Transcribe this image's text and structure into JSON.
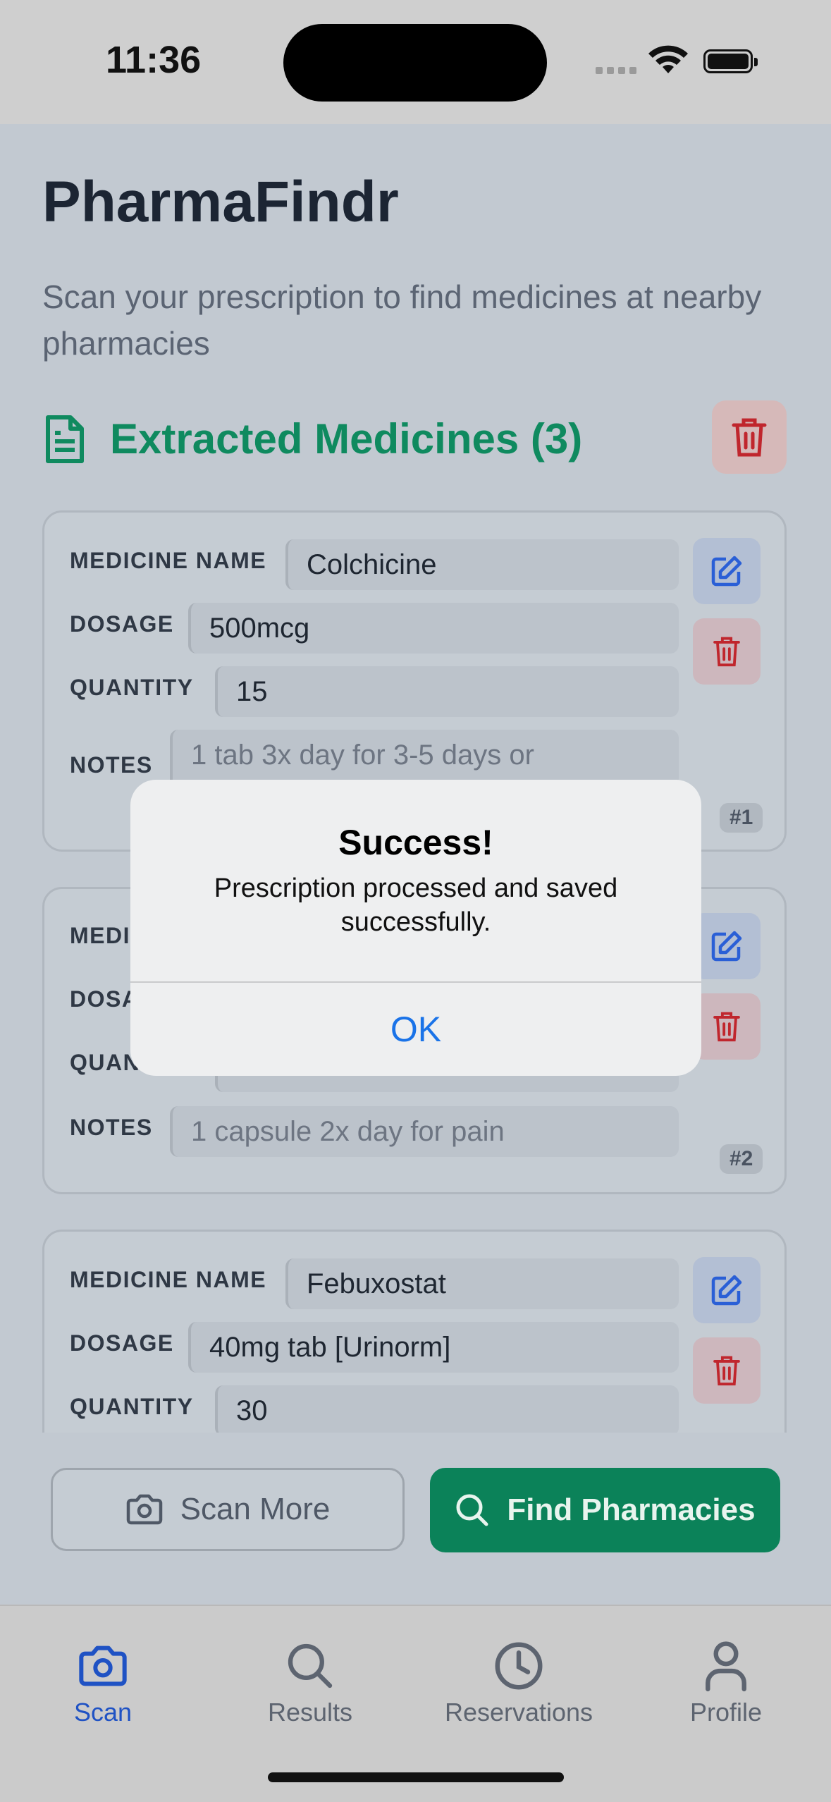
{
  "status_bar": {
    "time": "11:36"
  },
  "header": {
    "title": "PharmaFindr",
    "subtitle": "Scan your prescription to find medicines at nearby pharmacies"
  },
  "section": {
    "title": "Extracted Medicines (3)"
  },
  "labels": {
    "medicine_name": "MEDICINE NAME",
    "dosage": "DOSAGE",
    "quantity": "QUANTITY",
    "notes": "NOTES"
  },
  "medicines": [
    {
      "name": "Colchicine",
      "dosage": "500mcg",
      "quantity": "15",
      "notes": "1 tab 3x day for 3-5 days or",
      "badge": "#1"
    },
    {
      "name": "",
      "dosage": "",
      "quantity": "",
      "notes": "1 capsule 2x day for pain",
      "badge": "#2"
    },
    {
      "name": "Febuxostat",
      "dosage": "40mg tab [Urinorm]",
      "quantity": "30",
      "notes": "",
      "badge": ""
    }
  ],
  "actions": {
    "scan_more": "Scan More",
    "find_pharmacies": "Find Pharmacies"
  },
  "tabs": [
    {
      "label": "Scan",
      "icon": "camera-icon",
      "active": true
    },
    {
      "label": "Results",
      "icon": "search-icon",
      "active": false
    },
    {
      "label": "Reservations",
      "icon": "clock-icon",
      "active": false
    },
    {
      "label": "Profile",
      "icon": "person-icon",
      "active": false
    }
  ],
  "alert": {
    "title": "Success!",
    "message": "Prescription processed and saved successfully.",
    "ok": "OK"
  },
  "colors": {
    "accent_green": "#0b8259",
    "accent_blue": "#1f52c4",
    "delete_red": "#c0262d"
  }
}
